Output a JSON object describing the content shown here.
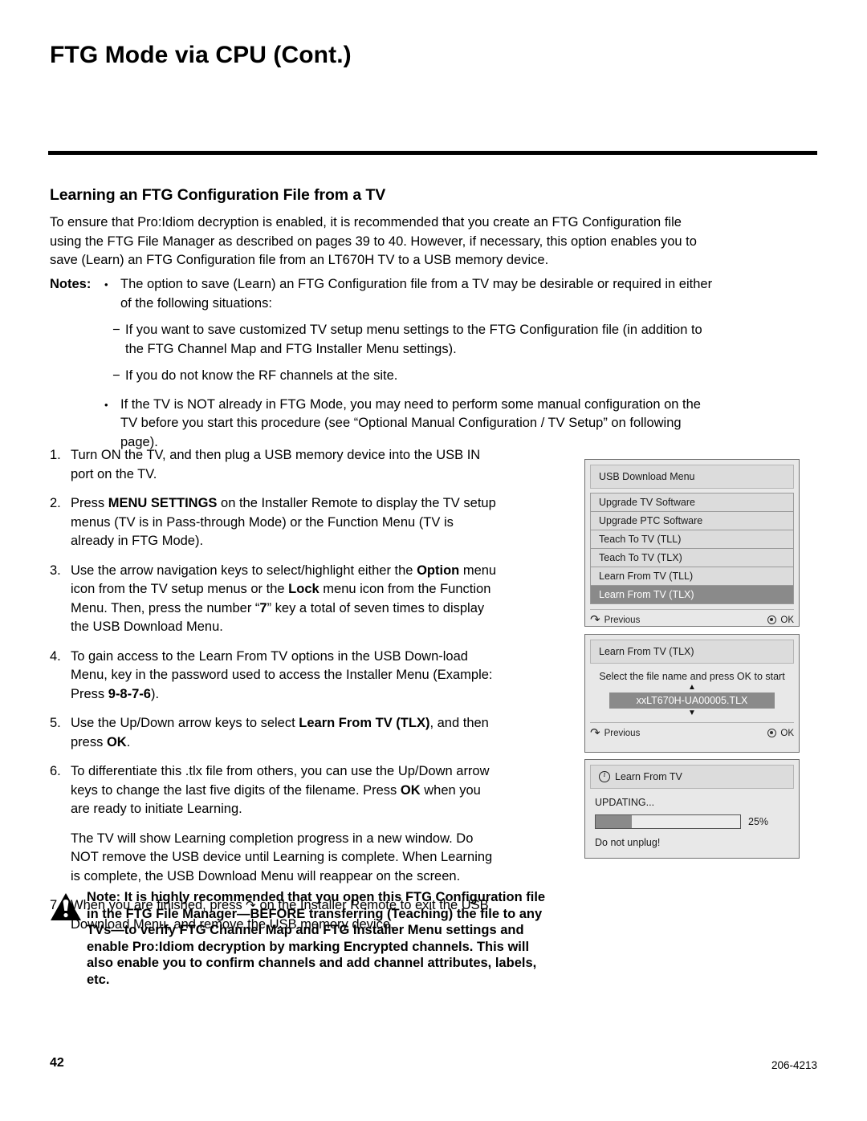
{
  "document": {
    "title": "FTG Mode via CPU (Cont.)",
    "section_heading": "Learning an FTG Configuration File from a TV",
    "intro": "To ensure that Pro:Idiom decryption is enabled, it is recommended that you create an FTG Configuration file using the FTG File Manager as described on pages 39 to 40. However, if necessary, this option enables you to save (Learn) an FTG Configuration file from an LT670H TV to a USB memory device."
  },
  "notes": {
    "label": "Notes:",
    "bullet": "•",
    "dash": "−",
    "item1": "The option to save (Learn) an FTG Configuration file from a TV may be desirable or required in either of the following situations:",
    "sub1": "If you want to save customized TV setup menu settings to the FTG Configuration file (in addition to the FTG Channel Map and FTG Installer Menu settings).",
    "sub2": "If you do not know the RF channels at the site.",
    "item2": "If the TV is NOT already in FTG Mode, you may need to perform some manual configuration on the TV before you start this procedure (see “Optional Manual Configuration / TV Setup” on following page)."
  },
  "steps": [
    {
      "num": "1.",
      "parts": [
        {
          "text": "Turn ON the TV, and then plug a USB memory device into the USB IN port on the TV.",
          "bold": false
        }
      ]
    },
    {
      "num": "2.",
      "parts": [
        {
          "text": "Press ",
          "bold": false
        },
        {
          "text": "MENU SETTINGS",
          "bold": true
        },
        {
          "text": " on the Installer Remote to display the TV setup menus (TV is in Pass-through Mode) or the Function Menu (TV is already in FTG Mode).",
          "bold": false
        }
      ]
    },
    {
      "num": "3.",
      "parts": [
        {
          "text": "Use the arrow navigation keys to select/highlight either the ",
          "bold": false
        },
        {
          "text": "Option",
          "bold": true
        },
        {
          "text": " menu icon from the TV setup menus or the ",
          "bold": false
        },
        {
          "text": "Lock",
          "bold": true
        },
        {
          "text": " menu icon from the Function Menu. Then, press the number “",
          "bold": false
        },
        {
          "text": "7",
          "bold": true
        },
        {
          "text": "” key a total of seven times to display the USB Download Menu.",
          "bold": false
        }
      ]
    },
    {
      "num": "4.",
      "parts": [
        {
          "text": "To gain access to the Learn From TV options in the USB Down-load Menu, key in the password used to access the Installer Menu (Example: Press ",
          "bold": false
        },
        {
          "text": "9-8-7-6",
          "bold": true
        },
        {
          "text": ").",
          "bold": false
        }
      ]
    },
    {
      "num": "5.",
      "parts": [
        {
          "text": "Use the Up/Down arrow keys to select ",
          "bold": false
        },
        {
          "text": "Learn From TV (TLX)",
          "bold": true
        },
        {
          "text": ", and then press ",
          "bold": false
        },
        {
          "text": "OK",
          "bold": true
        },
        {
          "text": ".",
          "bold": false
        }
      ]
    },
    {
      "num": "6.",
      "parts": [
        {
          "text": "To differentiate this .tlx file from others, you can use the Up/Down arrow keys to change the last five digits of the filename. Press ",
          "bold": false
        },
        {
          "text": "OK",
          "bold": true
        },
        {
          "text": " when you are ready to initiate Learning.",
          "bold": false
        }
      ]
    }
  ],
  "step6_extra": "The TV will show Learning completion progress in a new window. Do NOT remove the USB device until Learning is complete. When Learning is complete, the USB Download Menu will reappear on the screen.",
  "step7": {
    "num": "7.",
    "before": "When you are finished, press ",
    "icon": "↶",
    "after": " on the Installer Remote to exit the USB Download Menu, and remove the USB memory device."
  },
  "caution": {
    "icon_name": "warning-triangle-icon",
    "text": "Note: It is highly recommended that you open this FTG Configuration file in the FTG File Manager—BEFORE transferring (Teaching) the file to any TVs—to verify FTG Channel Map and FTG Installer Menu settings and enable Pro:Idiom decryption by marking Encrypted channels. This will also enable you to confirm channels and add channel attributes, labels, etc."
  },
  "footer": {
    "page_number": "42",
    "document_number": "206-4213"
  },
  "osd_panels": {
    "usb_download": {
      "title": "USB Download Menu",
      "items": [
        {
          "label": "Upgrade TV Software",
          "selected": false
        },
        {
          "label": "Upgrade PTC Software",
          "selected": false
        },
        {
          "label": "Teach To TV (TLL)",
          "selected": false
        },
        {
          "label": "Teach To TV (TLX)",
          "selected": false
        },
        {
          "label": "Learn From TV (TLL)",
          "selected": false
        },
        {
          "label": "Learn From TV (TLX)",
          "selected": true
        }
      ],
      "previous_label": "Previous",
      "ok_label": "OK"
    },
    "learn_tlx": {
      "title": "Learn From TV (TLX)",
      "prompt": "Select the file name and press OK to start",
      "up_arrow": "▲",
      "down_arrow": "▼",
      "filename": "xxLT670H-UA00005.TLX",
      "previous_label": "Previous",
      "ok_label": "OK"
    },
    "progress": {
      "title": "Learn From TV",
      "status": "UPDATING...",
      "percent_label": "25%",
      "percent_value": 25,
      "footer": "Do not unplug!"
    }
  },
  "colors": {
    "panel_bg": "#e8e8e8",
    "panel_header": "#dcdcdc",
    "highlight": "#8a8a8a",
    "border": "#6f6f6f"
  }
}
